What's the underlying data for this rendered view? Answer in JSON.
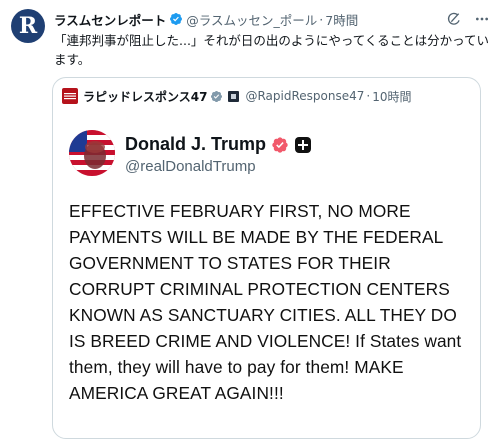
{
  "tweet": {
    "author_initial": "R",
    "author_name": "ラスムセンレポート",
    "author_handle": "@ラスムッセン_ポール",
    "separator": "·",
    "time": "7時間",
    "text": "「連邦判事が阻止した...」それが日の出のようにやってくることは分かっています。"
  },
  "quote": {
    "author_name": "ラピッドレスポンス47",
    "author_handle": "@RapidResponse47",
    "separator": "·",
    "time": "10時間",
    "post": {
      "name": "Donald J. Trump",
      "handle": "@realDonaldTrump",
      "text": "EFFECTIVE FEBRUARY FIRST, NO MORE PAYMENTS WILL BE MADE BY THE FEDERAL GOVERNMENT TO STATES FOR THEIR CORRUPT CRIMINAL PROTECTION CENTERS KNOWN AS SANCTUARY CITIES. ALL THEY DO IS BREED CRIME AND VIOLENCE! If States want them, they will have to pay for them! MAKE AMERICA GREAT AGAIN!!!"
    }
  },
  "colors": {
    "verified_blue": "#1d9bf0",
    "pink_badge": "#f1596b",
    "muted_text": "#536471",
    "border": "#cfd9de"
  },
  "icons": [
    "grok-icon",
    "more-icon",
    "verified-icon",
    "truth-verified-icon",
    "truth-plus-icon"
  ]
}
